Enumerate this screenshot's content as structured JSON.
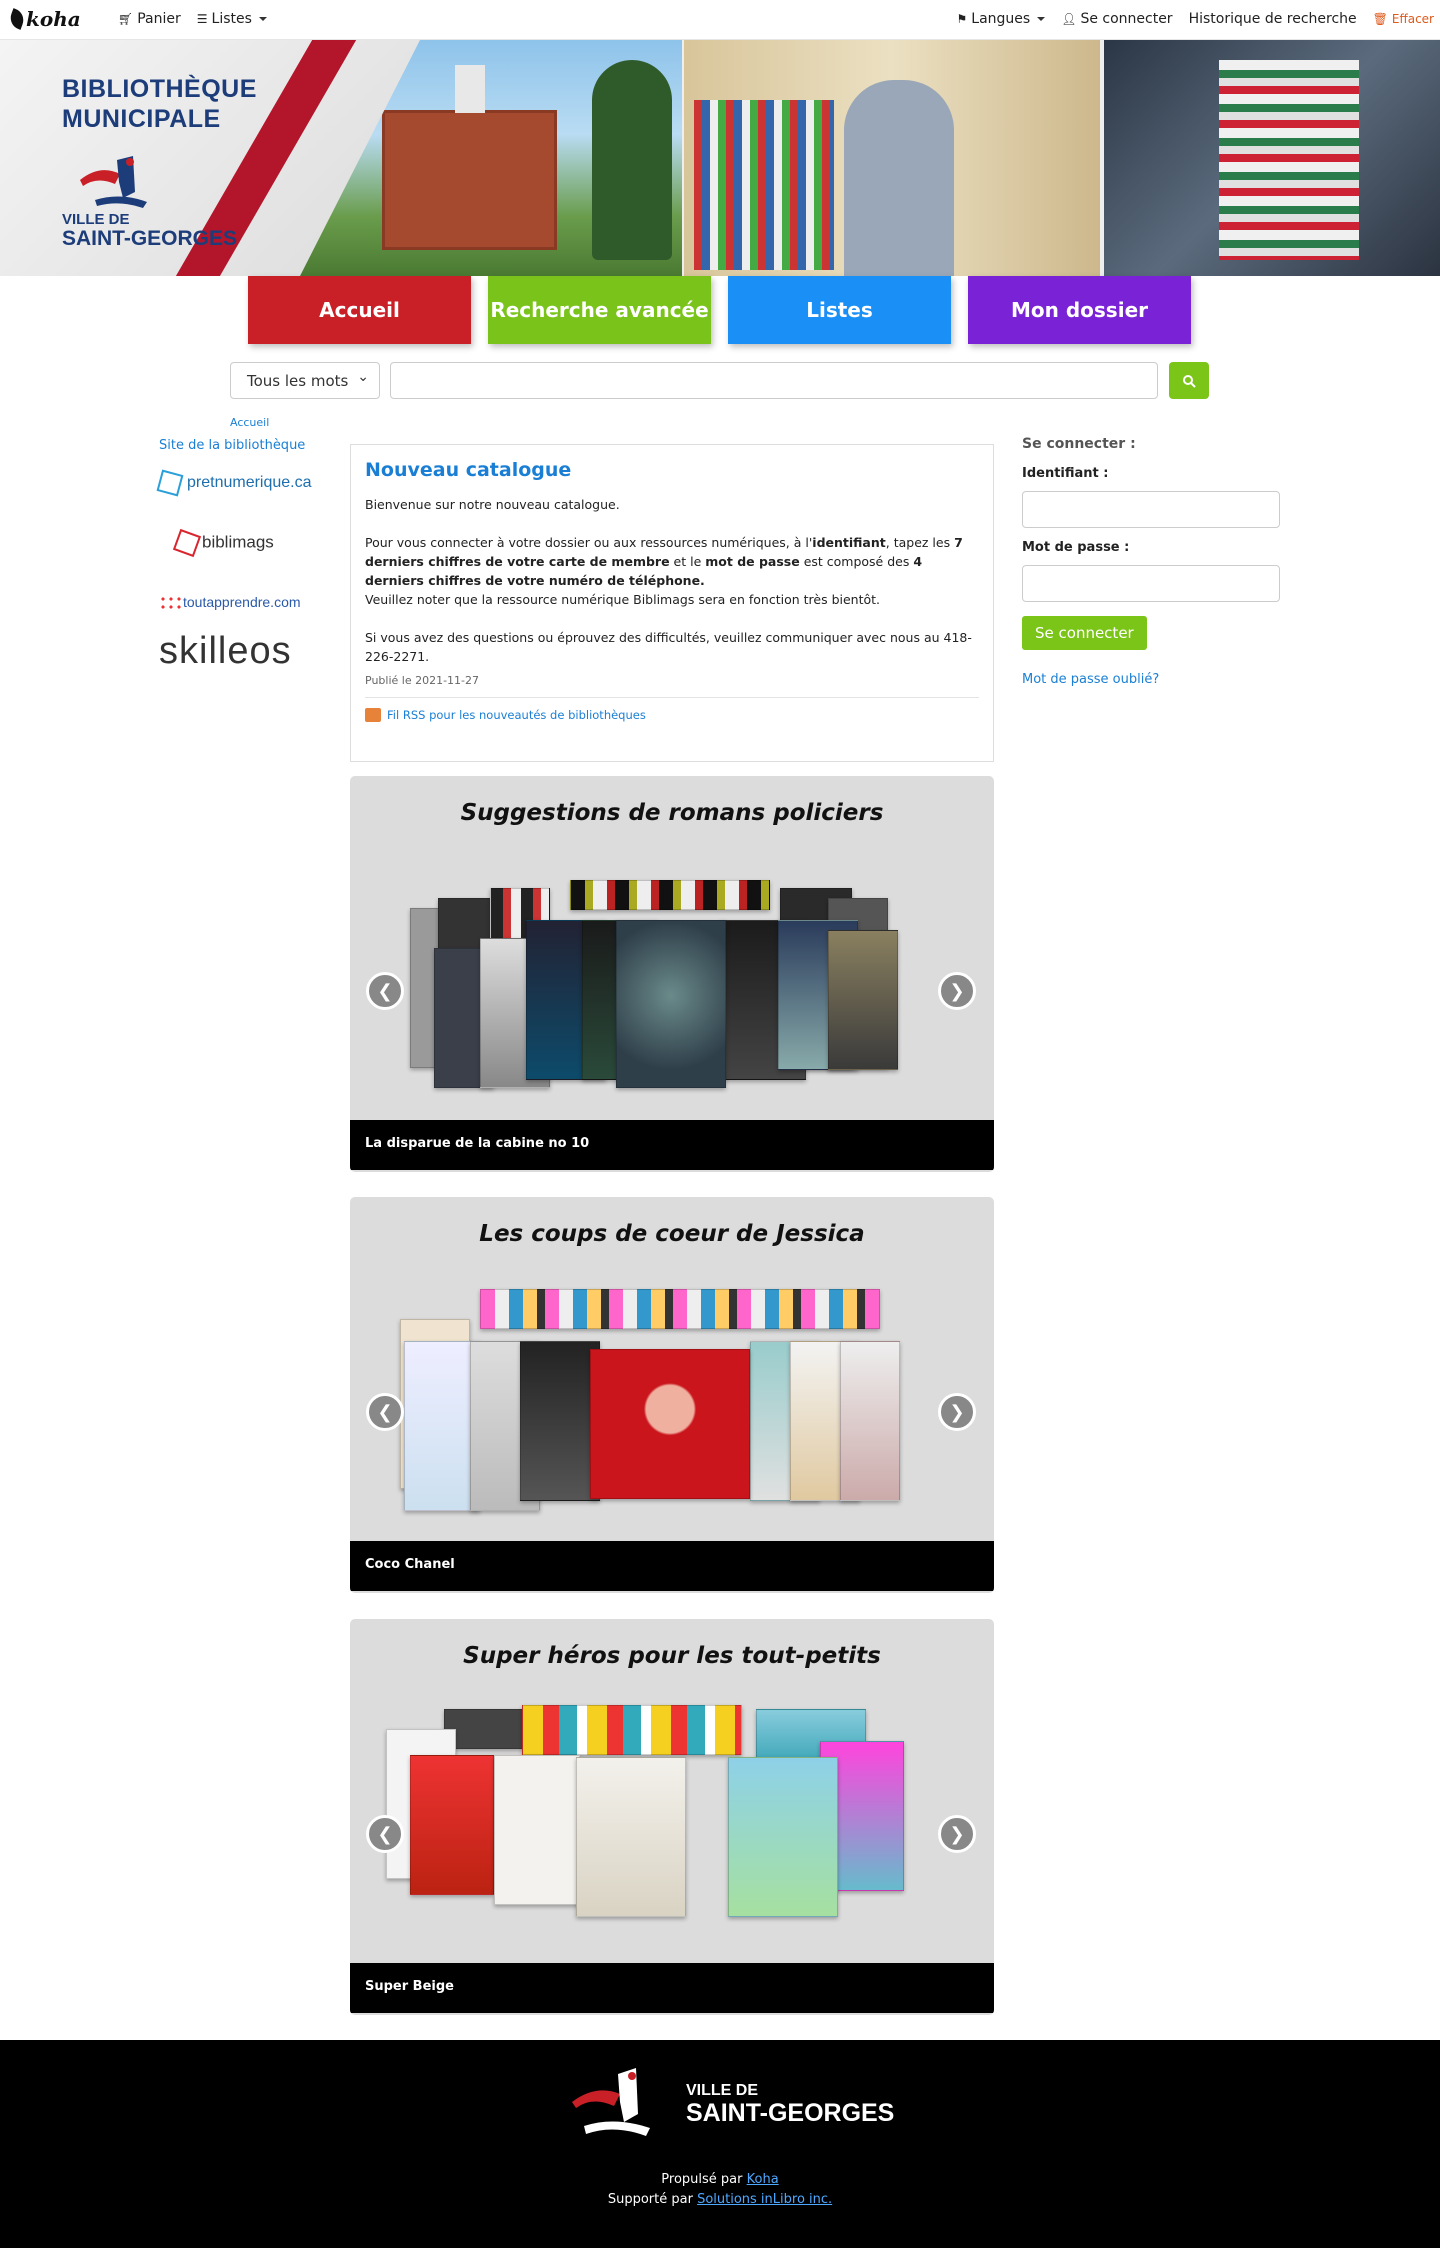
{
  "navbar": {
    "brand": "koha",
    "cart": "Panier",
    "lists": "Listes",
    "languages": "Langues",
    "login": "Se connecter",
    "history": "Historique de recherche",
    "clear": "Effacer"
  },
  "banner": {
    "title_line1": "BIBLIOTHÈQUE",
    "title_line2": "MUNICIPALE",
    "ville_small": "VILLE DE",
    "ville_large": "SAINT-GEORGES"
  },
  "mainnav": [
    {
      "label": "Accueil",
      "color": "#c92027"
    },
    {
      "label": "Recherche avancée",
      "color": "#7ac31b"
    },
    {
      "label": "Listes",
      "color": "#1a8ff5"
    },
    {
      "label": "Mon dossier",
      "color": "#7a22d6"
    }
  ],
  "search": {
    "scope": "Tous les mots",
    "query": ""
  },
  "breadcrumb": "Accueil",
  "sidebar": {
    "site_link": "Site de la bibliothèque",
    "partners": [
      "pretnumerique.ca",
      "biblimags",
      "toutapprendre.com",
      "skilleos"
    ]
  },
  "news": {
    "title": "Nouveau catalogue",
    "welcome": "Bienvenue sur notre nouveau catalogue.",
    "p1_a": "Pour vous connecter à votre dossier ou aux ressources numériques, à l'",
    "p1_b": "identifiant",
    "p1_c": ", tapez les ",
    "p1_d": "7 derniers chiffres de votre carte de membre",
    "p1_e": " et le ",
    "p1_f": "mot de passe",
    "p1_g": " est composé des ",
    "p1_h": "4 derniers chiffres de votre numéro de téléphone.",
    "p2": "Veuillez noter que la ressource numérique Biblimags sera en fonction très bientôt.",
    "p3": "Si vous avez des questions ou éprouvez des difficultés, veuillez communiquer avec nous au 418-226-2271.",
    "published": "Publié le 2021-11-27",
    "rss": "Fil RSS pour les nouveautés de bibliothèques"
  },
  "login": {
    "heading": "Se connecter :",
    "user_label": "Identifiant :",
    "pass_label": "Mot de passe :",
    "button": "Se connecter",
    "forgot": "Mot de passe oublié?"
  },
  "carousels": [
    {
      "title": "Suggestions de romans policiers",
      "caption": "La disparue de la cabine no 10"
    },
    {
      "title": "Les coups de coeur de Jessica",
      "caption": "Coco Chanel"
    },
    {
      "title": "Super héros pour les tout-petits",
      "caption": "Super Beige"
    }
  ],
  "footer": {
    "ville_small": "VILLE DE",
    "ville_large": "SAINT-GEORGES",
    "powered_prefix": "Propulsé par",
    "powered_link": "Koha",
    "support_prefix": "Supporté par",
    "support_link": "Solutions inLibro inc."
  }
}
